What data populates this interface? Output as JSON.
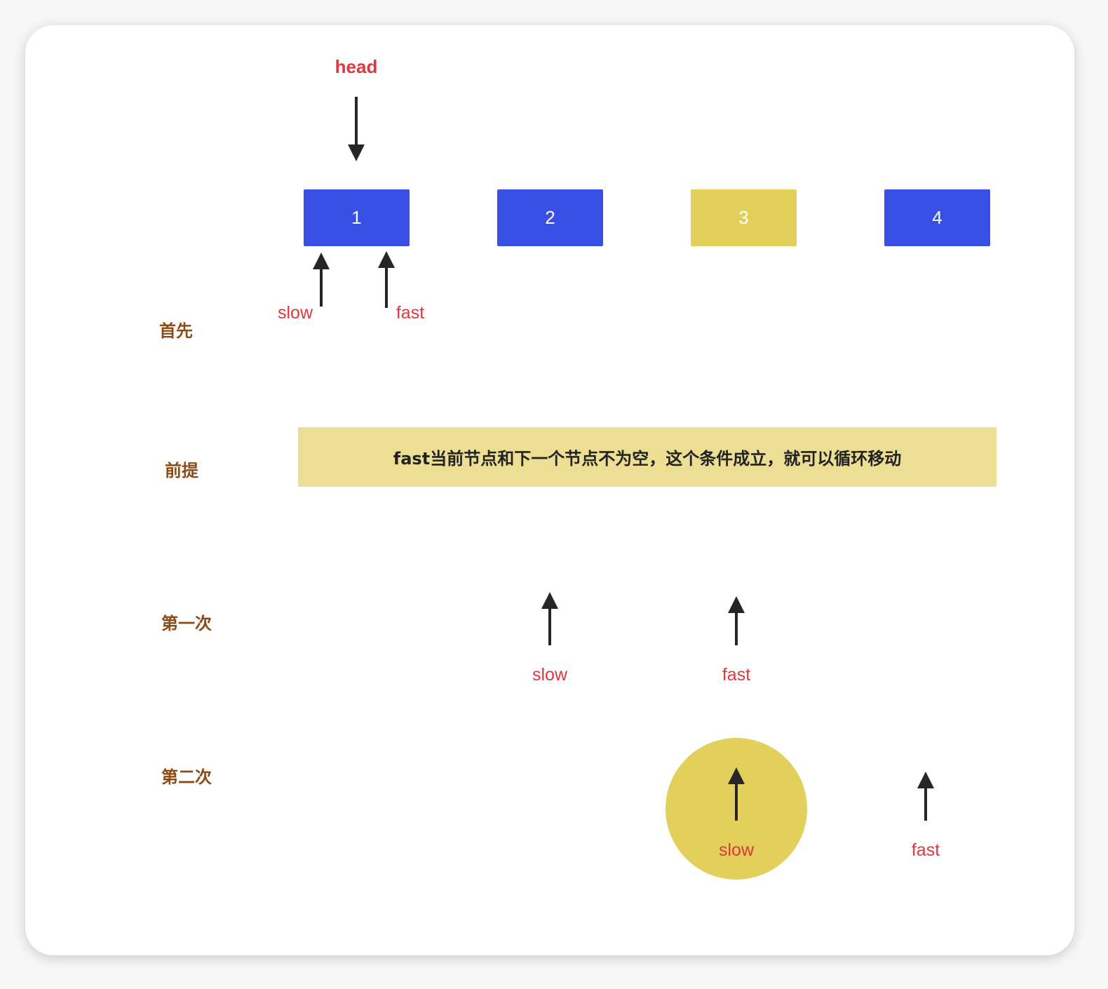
{
  "colors": {
    "node_blue": "#3850e3",
    "node_yellow": "#e3cf5c",
    "condition_bg": "#ecdf93",
    "pointer_label": "#e0363c",
    "row_label": "#8b4c17",
    "arrow": "#262626"
  },
  "head_label": "head",
  "nodes": [
    {
      "value": "1"
    },
    {
      "value": "2"
    },
    {
      "value": "3"
    },
    {
      "value": "4"
    }
  ],
  "rows": {
    "initial": {
      "label": "首先",
      "slow": "slow",
      "fast": "fast"
    },
    "premise": {
      "label": "前提",
      "condition": "fast当前节点和下一个节点不为空，这个条件成立，就可以循环移动"
    },
    "first": {
      "label": "第一次",
      "slow": "slow",
      "fast": "fast"
    },
    "second": {
      "label": "第二次",
      "slow": "slow",
      "fast": "fast"
    }
  }
}
